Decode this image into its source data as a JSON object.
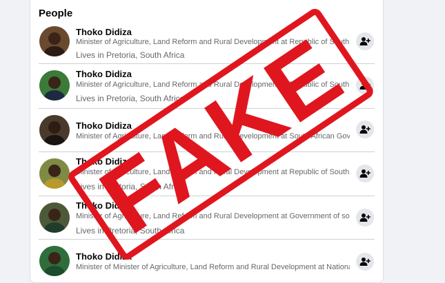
{
  "section_title": "People",
  "results": [
    {
      "name": "Thoko Didiza",
      "description": "Minister of Agriculture, Land Reform and Rural Development at Republic of South Africa - ...",
      "location": "Lives in Pretoria, South Africa",
      "avatar_bg": "#6a4a2f"
    },
    {
      "name": "Thoko Didiza",
      "description": "Minister of Agriculture, Land Reform and Rural Development at Republic of South Africa ...",
      "location": "Lives in Pretoria, South Africa",
      "avatar_bg": "#3c7a3a"
    },
    {
      "name": "Thoko Didiza",
      "description": "Minister of Agriculture, Land Reform and Rural Development at South African Government",
      "location": "",
      "avatar_bg": "#4a3a2c"
    },
    {
      "name": "Thoko Didiza",
      "description": "Minister of Agriculture, Land Reform and Rural Development at Republic of South Africa - ...",
      "location": "Lives in Pretoria, South Africa",
      "avatar_bg": "#7f8a45"
    },
    {
      "name": "Thoko Didiza",
      "description": "Minister of Agriculture, Land Reform and Rural Development at Government of south Afric...",
      "location": "Lives in Pretoria, South Africa",
      "avatar_bg": "#4c5a3a"
    },
    {
      "name": "Thoko Didiza",
      "description": "Minister of Minister of Agriculture, Land Reform and Rural Development at National Asse...",
      "location": "",
      "avatar_bg": "#2f6e3c"
    }
  ],
  "add_friend_icon": "add-person-icon",
  "stamp": {
    "text": "FAKE",
    "color": "#e0161f"
  }
}
